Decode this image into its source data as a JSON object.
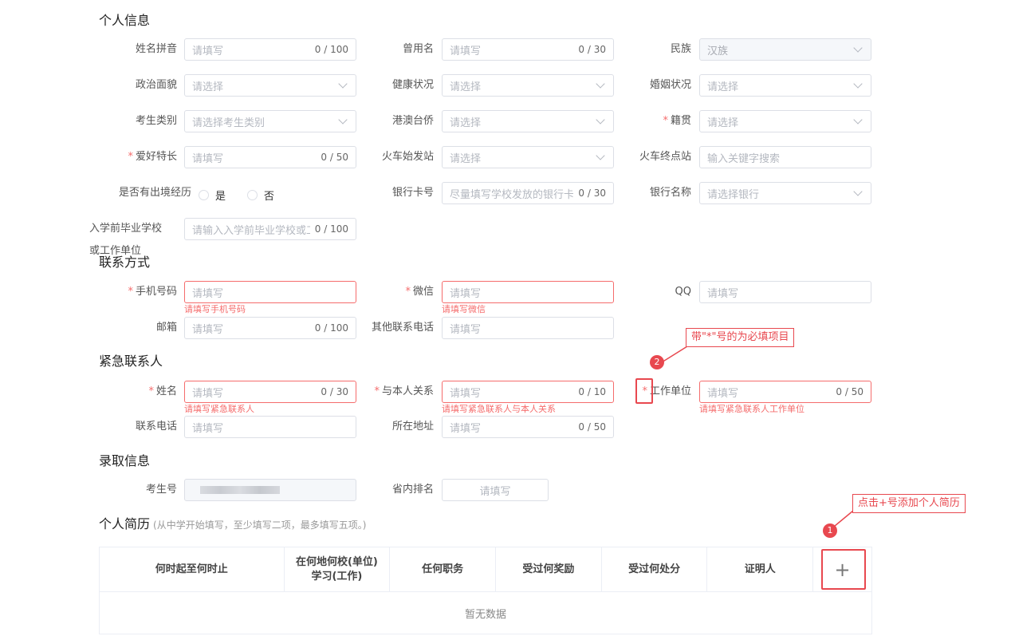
{
  "sections": {
    "personal": "个人信息",
    "contact": "联系方式",
    "emergency": "紧急联系人",
    "admission": "录取信息",
    "resume": "个人简历",
    "resume_note": "(从中学开始填写，至少填写二项，最多填写五项。)"
  },
  "personal": {
    "name_pinyin": {
      "label": "姓名拼音",
      "placeholder": "请填写",
      "count": "0 / 100"
    },
    "former_name": {
      "label": "曾用名",
      "placeholder": "请填写",
      "count": "0 / 30"
    },
    "ethnicity": {
      "label": "民族",
      "value": "汉族"
    },
    "political": {
      "label": "政治面貌",
      "placeholder": "请选择"
    },
    "health": {
      "label": "健康状况",
      "placeholder": "请选择"
    },
    "marital": {
      "label": "婚姻状况",
      "placeholder": "请选择"
    },
    "candidate_type": {
      "label": "考生类别",
      "placeholder": "请选择考生类别"
    },
    "hmt": {
      "label": "港澳台侨",
      "placeholder": "请选择"
    },
    "native_place": {
      "label": "籍贯",
      "placeholder": "请选择"
    },
    "hobby": {
      "label": "爱好特长",
      "placeholder": "请填写",
      "count": "0 / 50"
    },
    "train_from": {
      "label": "火车始发站",
      "placeholder": "请选择"
    },
    "train_to": {
      "label": "火车终点站",
      "placeholder": "输入关键字搜索"
    },
    "abroad": {
      "label": "是否有出境经历",
      "yes": "是",
      "no": "否"
    },
    "bank_card": {
      "label": "银行卡号",
      "placeholder": "尽量填写学校发放的银行卡",
      "count": "0 / 30"
    },
    "bank_name": {
      "label": "银行名称",
      "placeholder": "请选择银行"
    },
    "prev_school": {
      "label": "入学前毕业学校",
      "placeholder": "请输入入学前毕业学校或工",
      "count": "0 / 100",
      "label_wrap": "或工作单位"
    }
  },
  "contact": {
    "phone": {
      "label": "手机号码",
      "placeholder": "请填写",
      "error": "请填写手机号码"
    },
    "wechat": {
      "label": "微信",
      "placeholder": "请填写",
      "error": "请填写微信"
    },
    "qq": {
      "label": "QQ",
      "placeholder": "请填写"
    },
    "email": {
      "label": "邮箱",
      "placeholder": "请填写",
      "count": "0 / 100"
    },
    "other_phone": {
      "label": "其他联系电话",
      "placeholder": "请填写"
    }
  },
  "emergency": {
    "name": {
      "label": "姓名",
      "placeholder": "请填写",
      "count": "0 / 30",
      "error": "请填写紧急联系人"
    },
    "relation": {
      "label": "与本人关系",
      "placeholder": "请填写",
      "count": "0 / 10",
      "error": "请填写紧急联系人与本人关系"
    },
    "work_unit": {
      "label": "工作单位",
      "placeholder": "请填写",
      "count": "0 / 50",
      "error": "请填写紧急联系人工作单位"
    },
    "phone": {
      "label": "联系电话",
      "placeholder": "请填写"
    },
    "address": {
      "label": "所在地址",
      "placeholder": "请填写",
      "count": "0 / 50"
    }
  },
  "admission": {
    "exam_no": {
      "label": "考生号"
    },
    "rank": {
      "label": "省内排名",
      "placeholder": "请填写"
    }
  },
  "resume_table": {
    "columns": [
      "何时起至何时止",
      "在何地何校(单位)学习(工作)",
      "任何职务",
      "受过何奖励",
      "受过何处分",
      "证明人"
    ],
    "add": "+",
    "empty": "暂无数据"
  },
  "annotations": {
    "note1": "点击+号添加个人简历",
    "note2": "带\"*\"号的为必填项目",
    "badge1": "1",
    "badge2": "2",
    "color": "#e8484f"
  },
  "required_mark": "*"
}
